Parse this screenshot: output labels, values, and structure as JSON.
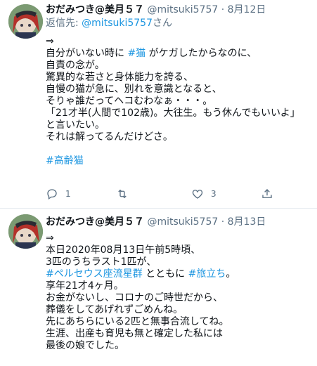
{
  "tweets": [
    {
      "name": "おだみつき@美月５７",
      "handle": "@mitsuki5757",
      "dot": "·",
      "date": "8月12日",
      "reply_prefix": "返信先: ",
      "reply_to": "@mitsuki5757",
      "reply_suffix": "さん",
      "lines": [
        {
          "parts": [
            {
              "text": "⇒",
              "tag": false
            }
          ]
        },
        {
          "parts": [
            {
              "text": "自分がいない時に ",
              "tag": false
            },
            {
              "text": "#猫",
              "tag": true
            },
            {
              "text": " がケガしたからなのに、",
              "tag": false
            }
          ]
        },
        {
          "parts": [
            {
              "text": "自責の念が。",
              "tag": false
            }
          ]
        },
        {
          "parts": [
            {
              "text": "驚異的な若さと身体能力を誇る、",
              "tag": false
            }
          ]
        },
        {
          "parts": [
            {
              "text": "自慢の猫が急に、別れを意識となると、",
              "tag": false
            }
          ]
        },
        {
          "parts": [
            {
              "text": "そりゃ誰だってヘコむわなぁ・・・。",
              "tag": false
            }
          ]
        },
        {
          "parts": [
            {
              "text": "「21才半(人間で102歳)。大往生。もう休んでもいいよ」",
              "tag": false
            }
          ]
        },
        {
          "parts": [
            {
              "text": "と言いたい。",
              "tag": false
            }
          ]
        },
        {
          "parts": [
            {
              "text": "それは解ってるんだけどさ。",
              "tag": false
            }
          ]
        },
        {
          "parts": []
        },
        {
          "parts": [
            {
              "text": "#高齢猫",
              "tag": true
            }
          ]
        }
      ],
      "reply_count": "1",
      "retweet_count": "",
      "like_count": "3"
    },
    {
      "name": "おだみつき@美月５７",
      "handle": "@mitsuki5757",
      "dot": "·",
      "date": "8月13日",
      "lines": [
        {
          "parts": [
            {
              "text": "⇒",
              "tag": false
            }
          ]
        },
        {
          "parts": [
            {
              "text": "本日2020年08月13日午前5時頃、",
              "tag": false
            }
          ]
        },
        {
          "parts": [
            {
              "text": "3匹のうちラスト1匹が、",
              "tag": false
            }
          ]
        },
        {
          "parts": [
            {
              "text": "#ペルセウス座流星群",
              "tag": true
            },
            {
              "text": " とともに ",
              "tag": false
            },
            {
              "text": "#旅立ち",
              "tag": true
            },
            {
              "text": "。",
              "tag": false
            }
          ]
        },
        {
          "parts": [
            {
              "text": "享年21才4ヶ月。",
              "tag": false
            }
          ]
        },
        {
          "parts": [
            {
              "text": "お金がないし、コロナのご時世だから、",
              "tag": false
            }
          ]
        },
        {
          "parts": [
            {
              "text": "葬儀をしてあげれずごめんね。",
              "tag": false
            }
          ]
        },
        {
          "parts": [
            {
              "text": "先にあちらにいる2匹と無事合流してね。",
              "tag": false
            }
          ]
        },
        {
          "parts": [
            {
              "text": "生涯、出産も育児も無と確定した私には",
              "tag": false
            }
          ]
        },
        {
          "parts": [
            {
              "text": "最後の娘でした。",
              "tag": false
            }
          ]
        }
      ]
    }
  ],
  "colors": {
    "link": "#1b95e0",
    "muted": "#5b7083",
    "text": "#0f1419"
  },
  "icons": [
    "avatar",
    "reply-icon",
    "retweet-icon",
    "like-icon",
    "share-icon",
    "more-icon"
  ]
}
